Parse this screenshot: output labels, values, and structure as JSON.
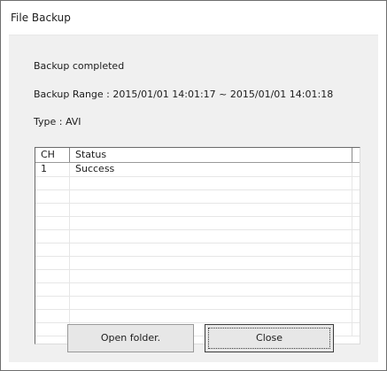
{
  "window": {
    "title": "File Backup"
  },
  "info": {
    "status_text": "Backup completed",
    "range_text": "Backup Range : 2015/01/01 14:01:17 ~ 2015/01/01 14:01:18",
    "type_text": "Type : AVI"
  },
  "list": {
    "columns": {
      "ch": "CH",
      "status": "Status"
    },
    "rows": [
      {
        "ch": "1",
        "status": "Success"
      },
      {
        "ch": "",
        "status": ""
      },
      {
        "ch": "",
        "status": ""
      },
      {
        "ch": "",
        "status": ""
      },
      {
        "ch": "",
        "status": ""
      },
      {
        "ch": "",
        "status": ""
      },
      {
        "ch": "",
        "status": ""
      },
      {
        "ch": "",
        "status": ""
      },
      {
        "ch": "",
        "status": ""
      },
      {
        "ch": "",
        "status": ""
      },
      {
        "ch": "",
        "status": ""
      },
      {
        "ch": "",
        "status": ""
      },
      {
        "ch": "",
        "status": ""
      }
    ]
  },
  "buttons": {
    "open_folder": "Open folder.",
    "close": "Close"
  }
}
